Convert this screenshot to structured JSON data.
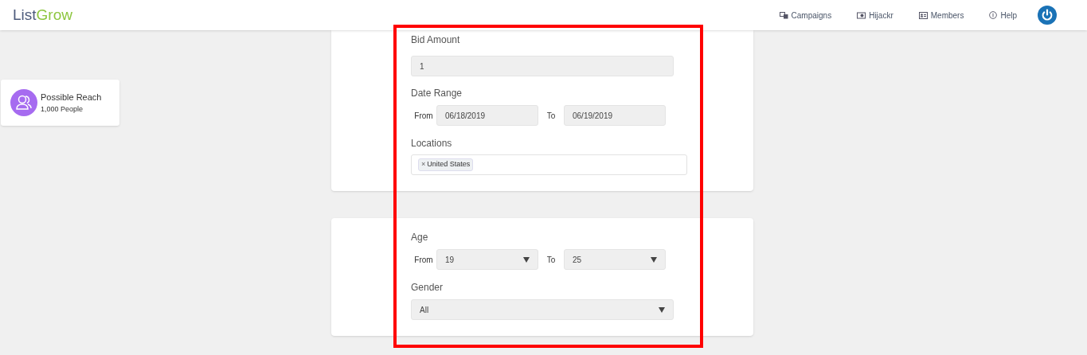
{
  "header": {
    "logo": [
      {
        "text": "List",
        "kind": "dark"
      },
      {
        "text": "Grow",
        "kind": "green"
      }
    ],
    "nav": [
      {
        "label": "Campaigns",
        "kind": "campaigns"
      },
      {
        "label": "Hijackr",
        "kind": "hijackr"
      },
      {
        "label": "Members",
        "kind": "members"
      },
      {
        "label": "Help",
        "kind": "help"
      }
    ]
  },
  "reach": {
    "title": "Possible Reach",
    "value": "1,000 People"
  },
  "budget_card": {
    "bid_amount": {
      "label": "Bid Amount",
      "value": "1"
    },
    "date_range": {
      "label": "Date Range",
      "from_label": "From",
      "from": "06/18/2019",
      "to_label": "To",
      "to": "06/19/2019"
    },
    "locations": {
      "label": "Locations",
      "tags": [
        {
          "remove": "×",
          "text": "United States"
        }
      ]
    }
  },
  "audience_card": {
    "age": {
      "label": "Age",
      "from_label": "From",
      "from": "19",
      "to_label": "To",
      "to": "25"
    },
    "gender": {
      "label": "Gender",
      "value": "All"
    }
  }
}
